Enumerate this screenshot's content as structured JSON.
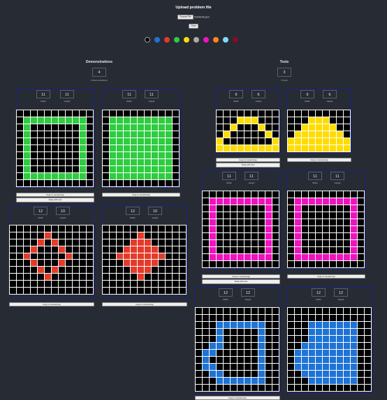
{
  "header": {
    "title": "Upload problem file"
  },
  "upload": {
    "button_label": "Choose File",
    "filename": "f3ab8eb6.json",
    "clear_label": "Clear"
  },
  "palette": [
    "#000000",
    "#1e73d6",
    "#e53a29",
    "#2ecc40",
    "#ffdc00",
    "#aaaaaa",
    "#f012be",
    "#ff851b",
    "#7fdbff",
    "#870c25"
  ],
  "sections": {
    "demonstrations": {
      "title": "Demonstrations",
      "count": "4",
      "count_label": "# Demonstrations"
    },
    "tests": {
      "title": "Tests",
      "count": "3",
      "count_label": "# Tests"
    }
  },
  "labels": {
    "width": "Width",
    "height": "Height",
    "copy": "Copy to countercopy",
    "swap": "Swap with next"
  },
  "colors": {
    "0": "#000000",
    "1": "#1e73d6",
    "2": "#e53a29",
    "3": "#2ecc40",
    "4": "#ffdc00",
    "6": "#f012be"
  },
  "demo_pairs": [
    {
      "input": {
        "width": 11,
        "height": 11,
        "rows": [
          "00000000000",
          "03333333330",
          "03000000030",
          "03000000030",
          "03000000030",
          "03000000030",
          "03000000030",
          "03000000030",
          "03000000030",
          "03333333330",
          "00000000000"
        ]
      },
      "output": {
        "width": 11,
        "height": 11,
        "rows": [
          "00000000000",
          "03333333330",
          "03333333330",
          "03333333330",
          "03333333330",
          "03333333330",
          "03333333330",
          "03333333330",
          "03333333330",
          "03333333330",
          "00000000000"
        ]
      }
    },
    {
      "input": {
        "width": 12,
        "height": 10,
        "rows": [
          "000000000000",
          "000002000000",
          "000020200000",
          "000200020000",
          "002000002000",
          "000200020000",
          "000020200000",
          "000002000000",
          "000000000000",
          "000000000000"
        ]
      },
      "output": {
        "width": 12,
        "height": 10,
        "rows": [
          "000000000000",
          "000002000000",
          "000022200000",
          "000222220000",
          "002222222000",
          "000222220000",
          "000022200000",
          "000002000000",
          "000000000000",
          "000000000000"
        ]
      }
    }
  ],
  "test_pairs": [
    {
      "input": {
        "width": 9,
        "height": 6,
        "rows": [
          "000000000",
          "000444000",
          "004000400",
          "040000040",
          "400000004",
          "444444444"
        ]
      },
      "output": {
        "width": 9,
        "height": 6,
        "rows": [
          "000000000",
          "000444000",
          "004444400",
          "044444440",
          "444444444",
          "444444444"
        ]
      }
    },
    {
      "input": {
        "width": 11,
        "height": 11,
        "rows": [
          "00000000000",
          "06666666660",
          "06000000060",
          "06000000060",
          "06000000060",
          "06000000060",
          "06000000060",
          "06000000060",
          "06000000060",
          "06666666660",
          "00000000000"
        ]
      },
      "output": {
        "width": 11,
        "height": 11,
        "rows": [
          "00000000000",
          "06666666660",
          "06000000060",
          "06000000060",
          "06000000060",
          "06000000060",
          "06000000060",
          "06000000060",
          "06000000060",
          "06666666660",
          "00000000000"
        ]
      }
    },
    {
      "input": {
        "width": 12,
        "height": 12,
        "rows": [
          "000000000000",
          "000000000000",
          "000111111100",
          "000100000100",
          "000100000100",
          "001100000100",
          "011000000100",
          "010000000100",
          "011000000100",
          "001100000100",
          "000111111100",
          "000000000000"
        ]
      },
      "output": {
        "width": 12,
        "height": 12,
        "rows": [
          "000000000000",
          "000000000000",
          "000111111100",
          "000111111100",
          "000111111100",
          "001111111100",
          "011111111100",
          "011111111100",
          "011111111100",
          "001111111100",
          "000111111100",
          "000000000000"
        ]
      }
    }
  ]
}
